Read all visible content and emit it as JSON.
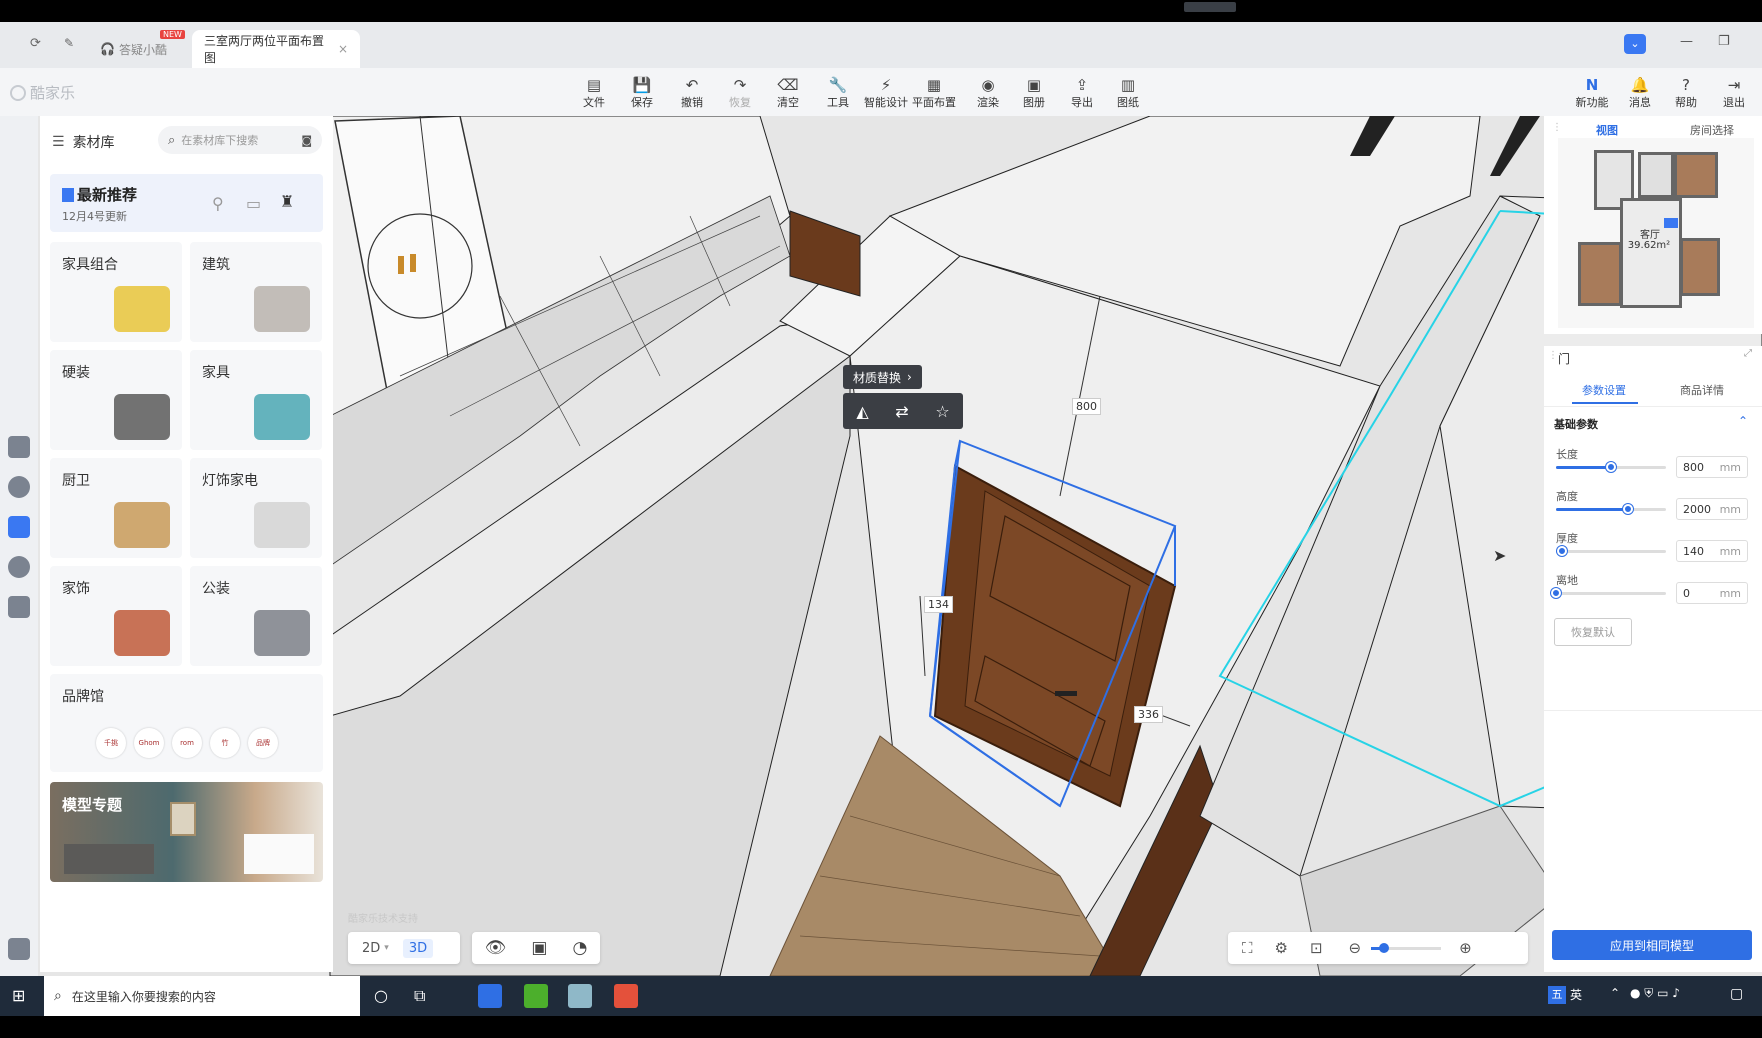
{
  "tabs": {
    "support_label": "答疑小酷",
    "new_badge": "NEW",
    "active_label": "三室两厅两位平面布置图",
    "close_glyph": "×"
  },
  "brand": {
    "logo_text": "酷家乐"
  },
  "toolbar": {
    "items": [
      {
        "label": "文件",
        "icon": "file-icon"
      },
      {
        "label": "保存",
        "icon": "save-icon"
      },
      {
        "label": "撤销",
        "icon": "undo-icon"
      },
      {
        "label": "恢复",
        "icon": "redo-icon"
      },
      {
        "label": "清空",
        "icon": "eraser-icon"
      },
      {
        "label": "工具",
        "icon": "wrench-icon"
      },
      {
        "label": "智能设计",
        "icon": "lightning-icon"
      },
      {
        "label": "平面布置",
        "icon": "layout-icon"
      },
      {
        "label": "渲染",
        "icon": "camera-icon"
      },
      {
        "label": "图册",
        "icon": "album-icon"
      },
      {
        "label": "导出",
        "icon": "export-icon"
      },
      {
        "label": "图纸",
        "icon": "drawing-icon"
      }
    ],
    "right_items": [
      {
        "label": "新功能",
        "icon": "new-feature-icon"
      },
      {
        "label": "消息",
        "icon": "bell-icon"
      },
      {
        "label": "帮助",
        "icon": "help-icon"
      },
      {
        "label": "退出",
        "icon": "logout-icon"
      }
    ]
  },
  "library": {
    "title": "素材库",
    "search_placeholder": "在素材库下搜索",
    "recommend_title": "最新推荐",
    "recommend_date": "12月4号更新",
    "categories": [
      "家具组合",
      "建筑",
      "硬装",
      "家具",
      "厨卫",
      "灯饰家电",
      "家饰",
      "公装"
    ],
    "brand_hall": "品牌馆",
    "brand_logos": [
      "千挑",
      "Ghom",
      "rom",
      "竹",
      "品牌"
    ],
    "model_topic": "模型专题"
  },
  "canvas": {
    "context_menu_title": "材质替换",
    "context_menu_arrow": "›",
    "dim_top": "800",
    "dim_left": "134",
    "dim_right": "336",
    "view_2d": "2D",
    "view_3d": "3D",
    "watermark": "酷家乐技术支持"
  },
  "minimap": {
    "tab_view": "视图",
    "tab_room": "房间选择",
    "room_name": "客厅",
    "room_area": "39.62m²"
  },
  "props": {
    "title": "门",
    "tab_params": "参数设置",
    "tab_details": "商品详情",
    "section_title": "基础参数",
    "params": [
      {
        "label": "长度",
        "value": "800",
        "unit": "mm",
        "level": 0.5
      },
      {
        "label": "高度",
        "value": "2000",
        "unit": "mm",
        "level": 0.65
      },
      {
        "label": "厚度",
        "value": "140",
        "unit": "mm",
        "level": 0.05
      },
      {
        "label": "离地",
        "value": "0",
        "unit": "mm",
        "level": 0.0
      }
    ],
    "reset_label": "恢复默认",
    "apply_label": "应用到相同模型"
  },
  "taskbar": {
    "search_placeholder": "在这里输入你要搜索的内容",
    "ime_label": "英"
  },
  "colors": {
    "accent": "#2f6fe4",
    "selection_cyan": "#27d3e6",
    "door_wood": "#6b3b1c",
    "floor_wood": "#a88a67"
  }
}
